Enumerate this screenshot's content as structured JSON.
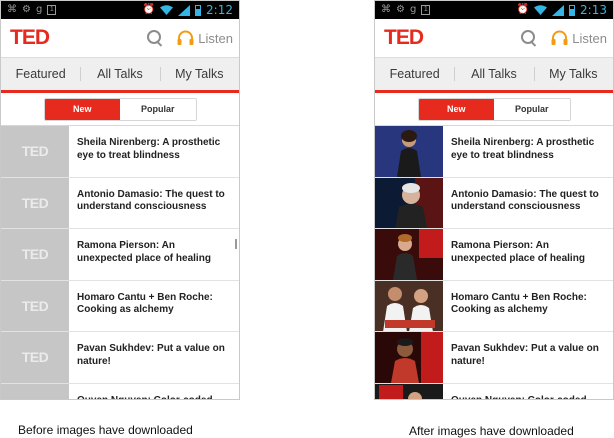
{
  "status_bar": {
    "left": {
      "time": "2:12"
    },
    "right": {
      "time": "2:13"
    },
    "box_label": "1"
  },
  "header": {
    "logo": "TED",
    "listen_label": "Listen"
  },
  "tabs": [
    {
      "label": "Featured",
      "active": true
    },
    {
      "label": "All Talks",
      "active": false
    },
    {
      "label": "My Talks",
      "active": false
    }
  ],
  "segments": {
    "new_label": "New",
    "popular_label": "Popular",
    "selected": "New"
  },
  "placeholder_logo": "TED",
  "talks": [
    {
      "title": "Sheila Nirenberg: A prosthetic eye to treat blindness"
    },
    {
      "title": "Antonio Damasio: The quest to understand consciousness"
    },
    {
      "title": "Ramona Pierson: An unexpected place of healing"
    },
    {
      "title": "Homaro Cantu + Ben Roche: Cooking as alchemy"
    },
    {
      "title": "Pavan Sukhdev: Put a value on nature!"
    },
    {
      "title": "Quyen Nguyen: Color-coded"
    }
  ],
  "captions": {
    "left": "Before images have downloaded",
    "right": "After images have downloaded"
  },
  "colors": {
    "accent": "#e62b1e",
    "status_blue": "#33b5e5",
    "placeholder_gray": "#c6c6c6"
  }
}
